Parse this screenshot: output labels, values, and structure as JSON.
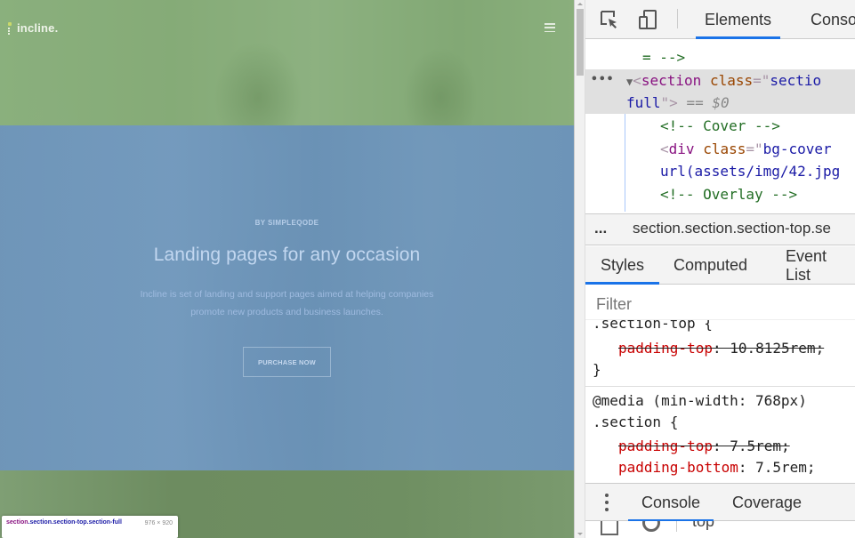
{
  "page": {
    "logo_text": "incline.",
    "eyebrow": "BY SIMPLEQODE",
    "headline": "Landing pages for any occasion",
    "lead": "Incline is set of landing and support pages aimed at helping companies promote new products and business launches.",
    "cta_label": "PURCHASE NOW",
    "overlay_colors": {
      "padding": "#93c47d",
      "content": "#6f96bf"
    }
  },
  "inspect_tooltip": {
    "tag": "section",
    "classes": ".section.section-top.section-full",
    "size": "976 × 920"
  },
  "devtools": {
    "toolbar": {
      "tabs": [
        {
          "label": "Elements",
          "active": true
        },
        {
          "label": "Conso",
          "active": false
        }
      ]
    },
    "dom": {
      "line0": "= -->",
      "selected_tag_open": "<",
      "selected_tag": "section",
      "selected_attr": "class",
      "selected_eq": "=\"",
      "selected_val_start": "sectio",
      "selected_val_end": "full",
      "selected_close": "\">",
      "selected_marker": "== $0",
      "comment_cover": "<!-- Cover -->",
      "div_tag_open": "<",
      "div_tag": "div",
      "div_attr": "class",
      "div_eq": "=\"",
      "div_val": "bg-cover",
      "div_url": "url(assets/img/42.jpg",
      "comment_overlay": "<!-- Overlay -->"
    },
    "breadcrumb": {
      "dots": "...",
      "path": "section.section.section-top.se"
    },
    "styles_tabs": [
      {
        "label": "Styles",
        "active": true
      },
      {
        "label": "Computed",
        "active": false
      },
      {
        "label": "Event List",
        "active": false
      }
    ],
    "filter_placeholder": "Filter",
    "rules": {
      "rule1_selector": ".section-top {",
      "rule1_prop": "padding-top",
      "rule1_value": ": 10.8125rem;",
      "rule1_close": "}",
      "rule2_media": "@media (min-width: 768px)",
      "rule2_selector": ".section {",
      "rule2_prop1": "padding-top",
      "rule2_value1": ": 7.5rem;",
      "rule2_prop2": "padding-bottom",
      "rule2_value2": ": 7.5rem;"
    },
    "drawer_tabs": [
      {
        "label": "Console",
        "active": true
      },
      {
        "label": "Coverage",
        "active": false
      }
    ],
    "console_context": "top"
  }
}
